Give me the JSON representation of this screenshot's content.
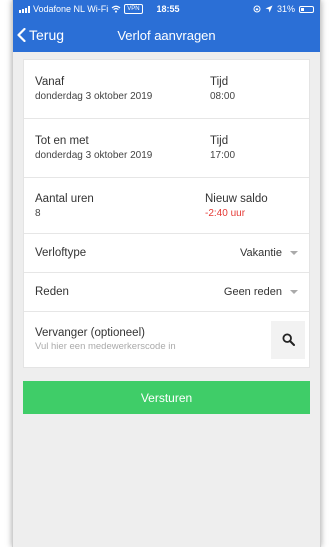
{
  "status_bar": {
    "carrier": "Vodafone NL Wi-Fi",
    "vpn": "VPN",
    "time": "18:55",
    "battery": "31%",
    "battery_level": 0.31
  },
  "nav": {
    "back_label": "Terug",
    "title": "Verlof aanvragen"
  },
  "form": {
    "from": {
      "label": "Vanaf",
      "date": "donderdag 3 oktober 2019",
      "time_label": "Tijd",
      "time": "08:00"
    },
    "to": {
      "label": "Tot en met",
      "date": "donderdag 3 oktober 2019",
      "time_label": "Tijd",
      "time": "17:00"
    },
    "hours": {
      "label": "Aantal uren",
      "value": "8",
      "balance_label": "Nieuw saldo",
      "balance": "-2:40 uur"
    },
    "leave_type": {
      "label": "Verloftype",
      "value": "Vakantie"
    },
    "reason": {
      "label": "Reden",
      "value": "Geen reden"
    },
    "substitute": {
      "label": "Vervanger (optioneel)",
      "placeholder": "Vul hier een medewerkerscode in"
    }
  },
  "submit_label": "Versturen",
  "colors": {
    "header": "#2b6fd6",
    "submit": "#3fcd68",
    "negative": "#e53935",
    "background": "#eeeeee"
  }
}
